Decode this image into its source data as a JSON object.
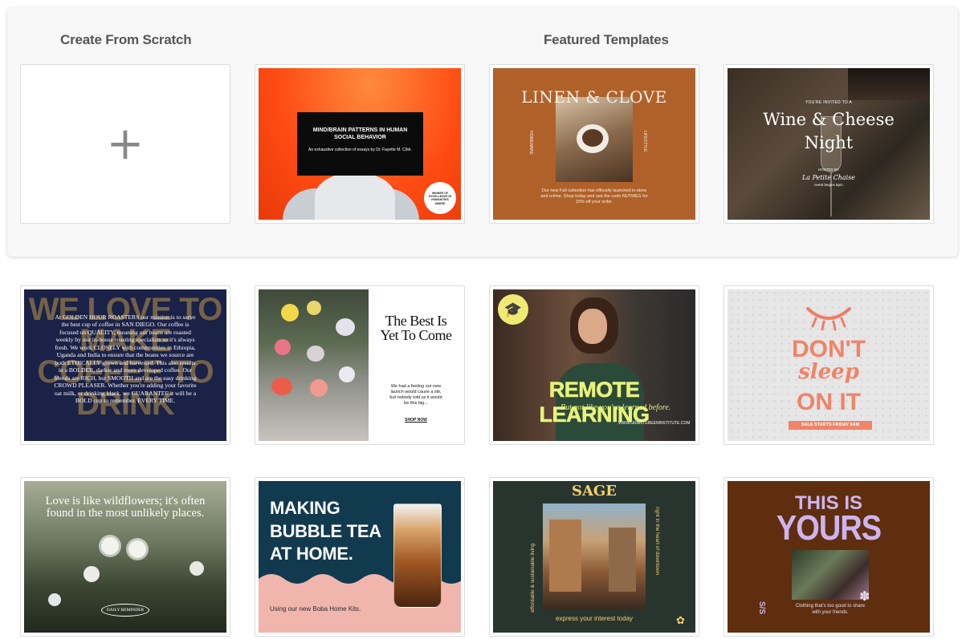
{
  "headings": {
    "scratch": "Create From Scratch",
    "featured": "Featured Templates"
  },
  "scratch": {
    "plus": "+"
  },
  "colors": {
    "panel_bg": "#f8f8f8",
    "card_border": "#dcdcdc"
  },
  "templates": {
    "mind": {
      "title": "MIND/BRAIN PATTERNS IN HUMAN SOCIAL BEHAVIOR",
      "subtitle": "An exhaustive collection of essays by Dr. Fayette M. Côté.",
      "seal": "WINNER OF EXCELLENCE IN HUMANITIES AWARD"
    },
    "linen": {
      "title": "LINEN & CLOVE",
      "side_left": "HOMEWARE",
      "side_right": "LIFESTYLE",
      "body": "Our new Fall collection has officially launched in-store and online. Shop today and use the code NUTMEG for 15% off your order."
    },
    "wine": {
      "invite": "YOU'RE INVITED TO A",
      "title": "Wine & Cheese Night",
      "hosted": "HOSTED BY",
      "venue": "La Petite Chaise",
      "time": "event begins 6pm"
    },
    "golden": {
      "bg_text": "WE LOVE TO MAKE COFFEE TO DRINK",
      "body": "At GOLDEN HOUR ROASTERS our mission is to serve the best cup of coffee in SAN DIEGO. Our coffee is focused on QUALITY, meaning our beans are roasted weekly by our in-house roasting specialists so it's always fresh. We work CLOSELY with communities in Ethiopia, Uganda and India to ensure that the beans we source are both ETHICALLY grown and harvested. This also results in a BOLDER, darker and more developed coffee. Our blends are RICH, but SMOOTH and are the easy drinking CROWD PLEASER. Whether you're adding your favorite oat milk, or drinking black, we GUARANTEE it will be a BOLD cup to remember. EVERY TIME."
    },
    "best": {
      "title": "The Best Is Yet To Come",
      "body": "We had a feeling our new launch would cause a stir, but nobody told us it would be this big...",
      "cta": "SHOP NOW"
    },
    "remote": {
      "title": "REMOTE LEARNING",
      "tagline": "But not like you've learned before.",
      "url": "WWW.GRANTGREENINSTITUTE.COM"
    },
    "sleep": {
      "line1": "DON'T",
      "line2": "sleep",
      "line3": "ON IT",
      "badge": "SALE STARTS FRIDAY 9AM"
    },
    "wild": {
      "quote": "Love is like wildflowers; it's often found in the most unlikely places.",
      "badge": "DAILY REMINDER"
    },
    "boba": {
      "title": "MAKING BUBBLE TEA AT HOME.",
      "body": "Using our new Boba Home Kits."
    },
    "sage": {
      "title": "SAGE",
      "side_left": "affordable & sustainable living",
      "side_right": "right in the heart of downtown",
      "bottom": "express your interest today"
    },
    "yours": {
      "line1": "THIS IS",
      "line2": "YOURS",
      "side": "S/S",
      "body": "Clothing that's too good to share with your friends."
    }
  }
}
